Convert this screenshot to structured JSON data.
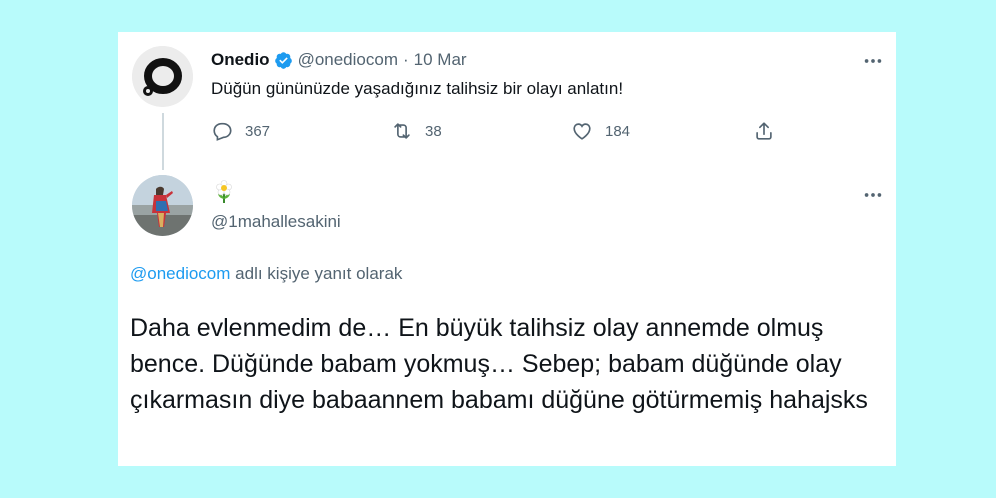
{
  "parent_tweet": {
    "author_name": "Onedio",
    "author_handle": "@onediocom",
    "separator": "·",
    "date": "10 Mar",
    "text": "Düğün gününüzde yaşadığınız talihsiz bir olayı anlatın!",
    "reply_count": "367",
    "retweet_count": "38",
    "like_count": "184",
    "icons": [
      "verified-badge-icon",
      "reply-icon",
      "retweet-icon",
      "like-icon",
      "share-icon",
      "more-icon"
    ]
  },
  "reply_tweet": {
    "display_name_icon": "flower-emoji-icon",
    "author_handle": "@1mahallesakini",
    "reply_to_handle": "@onediocom",
    "reply_to_suffix": " adlı kişiye yanıt olarak",
    "text": "Daha evlenmedim de… En büyük talihsiz olay annemde olmuş bence. Düğünde babam yokmuş… Sebep; babam düğünde olay çıkarmasın diye babaannem babamı düğüne götürmemiş hahajsks"
  },
  "colors": {
    "background": "#b8fbfb",
    "card": "#ffffff",
    "link": "#1d9bf0",
    "muted": "#536471",
    "text": "#0f1419"
  }
}
